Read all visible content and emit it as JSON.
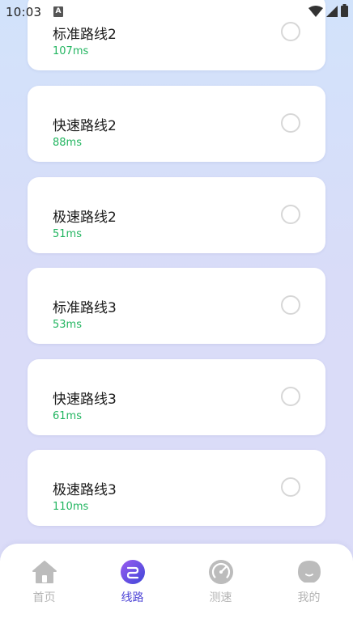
{
  "status_bar": {
    "time": "10:03",
    "notification_badge": "A",
    "icons": [
      "wifi-icon",
      "signal-icon",
      "battery-icon"
    ]
  },
  "routes": [
    {
      "name": "标准路线2",
      "latency": "107ms",
      "selected": false
    },
    {
      "name": "快速路线2",
      "latency": "88ms",
      "selected": false
    },
    {
      "name": "极速路线2",
      "latency": "51ms",
      "selected": false
    },
    {
      "name": "标准路线3",
      "latency": "53ms",
      "selected": false
    },
    {
      "name": "快速路线3",
      "latency": "61ms",
      "selected": false
    },
    {
      "name": "极速路线3",
      "latency": "110ms",
      "selected": false
    }
  ],
  "tabbar": {
    "tabs": [
      {
        "label": "首页",
        "icon": "home-icon",
        "active": false
      },
      {
        "label": "线路",
        "icon": "route-icon",
        "active": true
      },
      {
        "label": "测速",
        "icon": "speedometer-icon",
        "active": false
      },
      {
        "label": "我的",
        "icon": "profile-icon",
        "active": false
      }
    ]
  },
  "colors": {
    "accent": "#4d44d6",
    "latency": "#22b560",
    "inactive_tab": "#b4b4b4"
  }
}
